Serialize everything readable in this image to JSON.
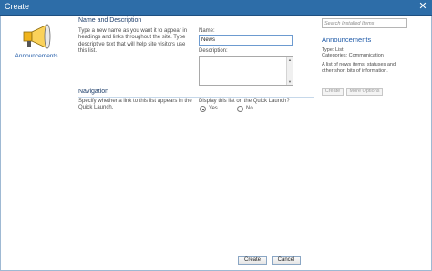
{
  "window": {
    "title": "Create",
    "close_glyph": "✕"
  },
  "left": {
    "icon": "megaphone-icon",
    "label": "Announcements"
  },
  "name_section": {
    "title": "Name and Description",
    "description": "Type a new name as you want it to appear in headings and links throughout the site. Type descriptive text that will help site visitors use this list.",
    "name_label": "Name:",
    "name_value": "News",
    "description_label": "Description:",
    "description_value": ""
  },
  "nav_section": {
    "title": "Navigation",
    "description": "Specify whether a link to this list appears in the Quick Launch.",
    "question": "Display this list on the Quick Launch?",
    "options": [
      {
        "label": "Yes",
        "checked": true
      },
      {
        "label": "No",
        "checked": false
      }
    ]
  },
  "right": {
    "search_placeholder": "Search Installed Items",
    "title": "Announcements",
    "type_line": "Type: List",
    "categories_line": "Categories: Communication",
    "description": "A list of news items, statuses and other short bits of information.",
    "create_label": "Create",
    "more_options_label": "More Options"
  },
  "footer": {
    "create_label": "Create",
    "cancel_label": "Cancel"
  },
  "colors": {
    "titlebar": "#2d6da8",
    "link": "#1f5aa8",
    "section_title": "#1f3f6b"
  }
}
